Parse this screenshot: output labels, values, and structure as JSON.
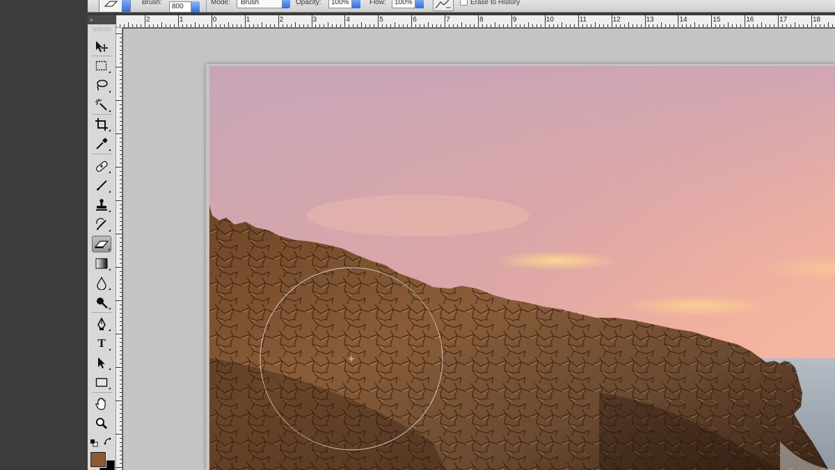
{
  "options_bar": {
    "brush_label": "Brush:",
    "brush_size": "800",
    "mode_label": "Mode:",
    "mode_value": "Brush",
    "opacity_label": "Opacity:",
    "opacity_value": "100%",
    "flow_label": "Flow:",
    "flow_value": "100%",
    "erase_to_history_label": "Erase to History"
  },
  "toolbox": {
    "header_glyph": "»",
    "tools": [
      {
        "name": "move-tool",
        "icon": "move-icon"
      },
      {
        "name": "marquee-tool",
        "icon": "rect-marquee-icon"
      },
      {
        "name": "lasso-tool",
        "icon": "lasso-icon"
      },
      {
        "name": "magic-wand-tool",
        "icon": "magic-wand-icon"
      },
      {
        "name": "crop-tool",
        "icon": "crop-icon"
      },
      {
        "name": "eyedropper-tool",
        "icon": "eyedropper-icon"
      },
      {
        "name": "healing-brush-tool",
        "icon": "bandage-icon"
      },
      {
        "name": "brush-tool",
        "icon": "brush-icon"
      },
      {
        "name": "clone-stamp-tool",
        "icon": "stamp-icon"
      },
      {
        "name": "history-brush-tool",
        "icon": "history-brush-icon"
      },
      {
        "name": "eraser-tool",
        "icon": "eraser-icon",
        "active": true
      },
      {
        "name": "gradient-tool",
        "icon": "gradient-icon"
      },
      {
        "name": "blur-tool",
        "icon": "drop-icon"
      },
      {
        "name": "dodge-tool",
        "icon": "dodge-icon"
      },
      {
        "name": "pen-tool",
        "icon": "pen-icon"
      },
      {
        "name": "type-tool",
        "icon": "type-icon",
        "glyph": "T"
      },
      {
        "name": "path-selection-tool",
        "icon": "arrow-icon"
      },
      {
        "name": "shape-tool",
        "icon": "rectangle-icon"
      },
      {
        "name": "hand-tool",
        "icon": "hand-icon"
      },
      {
        "name": "zoom-tool",
        "icon": "magnifier-icon"
      }
    ],
    "foreground_color": "#8a5a34",
    "background_color": "#000000"
  },
  "ruler": {
    "labels": [
      "2",
      "1",
      "0",
      "1",
      "2",
      "3",
      "4",
      "5",
      "6",
      "7",
      "8",
      "9",
      "10",
      "11",
      "12",
      "13",
      "14",
      "15",
      "16",
      "17",
      "18"
    ]
  },
  "colors": {
    "sky_top": "#c4a3b8",
    "sky_bottom": "#f7b49e",
    "cloud_glow": "#ffd58a",
    "rock": "#7a5232",
    "sea": "#b9c3cc",
    "highlight": "#2f6fd6"
  }
}
